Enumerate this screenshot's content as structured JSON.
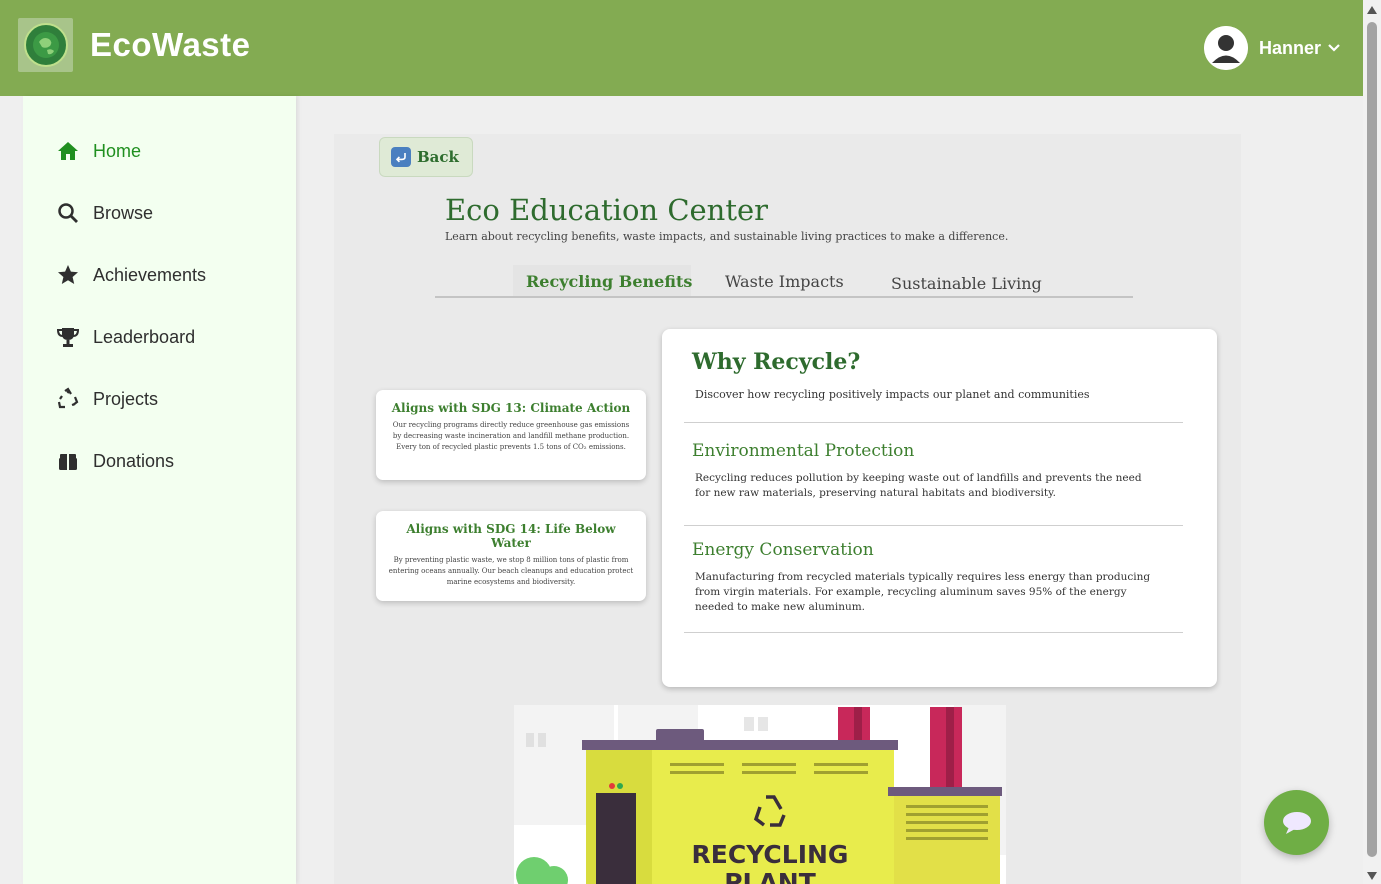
{
  "header": {
    "brand": "EcoWaste",
    "logo_text": "EcoWaste",
    "user_name": "Hanner"
  },
  "sidebar": {
    "items": [
      {
        "label": "Home",
        "icon": "home-icon",
        "active": true
      },
      {
        "label": "Browse",
        "icon": "search-icon",
        "active": false
      },
      {
        "label": "Achievements",
        "icon": "star-icon",
        "active": false
      },
      {
        "label": "Leaderboard",
        "icon": "trophy-icon",
        "active": false
      },
      {
        "label": "Projects",
        "icon": "recycle-icon",
        "active": false
      },
      {
        "label": "Donations",
        "icon": "gift-icon",
        "active": false
      }
    ]
  },
  "main": {
    "back_label": "Back",
    "title": "Eco Education Center",
    "subtitle": "Learn about recycling benefits, waste impacts, and sustainable living practices to make a difference.",
    "tabs": [
      {
        "label": "Recycling Benefits",
        "active": true
      },
      {
        "label": "Waste Impacts",
        "active": false
      },
      {
        "label": "Sustainable Living",
        "active": false
      }
    ],
    "sdg_cards": [
      {
        "title": "Aligns with SDG 13: Climate Action",
        "text": "Our recycling programs directly reduce greenhouse gas emissions by decreasing waste incineration and landfill methane production. Every ton of recycled plastic prevents 1.5 tons of CO₂ emissions."
      },
      {
        "title": "Aligns with SDG 14: Life Below Water",
        "text": "By preventing plastic waste, we stop 8 million tons of plastic from entering oceans annually. Our beach cleanups and education protect marine ecosystems and biodiversity."
      }
    ],
    "info": {
      "title": "Why Recycle?",
      "subtitle": "Discover how recycling positively impacts our planet and communities",
      "sections": [
        {
          "heading": "Environmental Protection",
          "text": "Recycling reduces pollution by keeping waste out of landfills and prevents the need for new raw materials, preserving natural habitats and biodiversity."
        },
        {
          "heading": "Energy Conservation",
          "text": "Manufacturing from recycled materials typically requires less energy than producing from virgin materials. For example, recycling aluminum saves 95% of the energy needed to make new aluminum."
        }
      ]
    },
    "illustration": {
      "line1": "RECYCLING",
      "line2": "PLANT"
    }
  },
  "colors": {
    "header": "#83ab52",
    "sidebar": "#f3fff0",
    "accent": "#3d7f2f",
    "chat_button": "#6fae45"
  }
}
